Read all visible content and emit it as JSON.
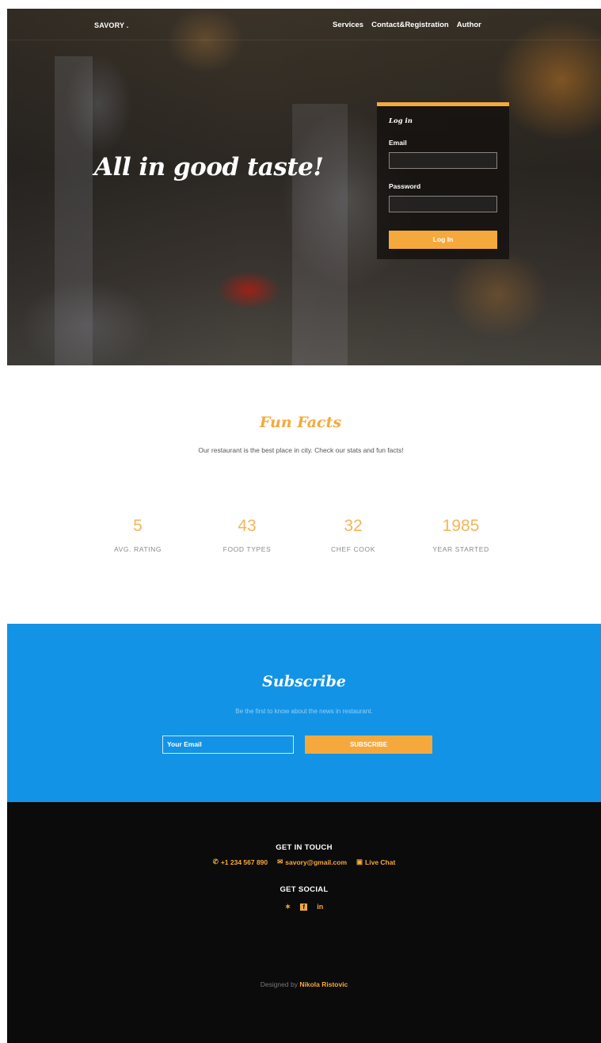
{
  "nav": {
    "brand": "SAVORY .",
    "links": [
      "Services",
      "Contact&Registration",
      "Author"
    ]
  },
  "hero": {
    "headline": "All in good taste!"
  },
  "login": {
    "title": "Log in",
    "email_label": "Email",
    "email_value": "",
    "password_label": "Password",
    "password_value": "",
    "button_label": "Log In"
  },
  "facts": {
    "title": "Fun Facts",
    "subtitle": "Our restaurant is the best place in city. Check our stats and fun facts!",
    "stats": [
      {
        "value": "5",
        "label": "AVG. RATING"
      },
      {
        "value": "43",
        "label": "FOOD TYPES"
      },
      {
        "value": "32",
        "label": "CHEF COOK"
      },
      {
        "value": "1985",
        "label": "YEAR STARTED"
      }
    ]
  },
  "subscribe": {
    "title": "Subscribe",
    "text": "Be the first to know about the news in restaurant.",
    "input_placeholder": "Your Email",
    "button_label": "SUBSCRIBE"
  },
  "footer": {
    "touch_heading": "GET IN TOUCH",
    "phone": "+1 234 567 890",
    "email": "savory@gmail.com",
    "chat": "Live Chat",
    "social_heading": "GET SOCIAL",
    "social_icons": [
      "twitter-icon",
      "facebook-icon",
      "linkedin-icon"
    ],
    "credit_prefix": "Designed by",
    "credit_name": "Nikola Ristovic"
  },
  "colors": {
    "accent": "#f5a93c",
    "subscribe_bg": "#1393e6",
    "footer_bg": "#0b0b0b"
  }
}
